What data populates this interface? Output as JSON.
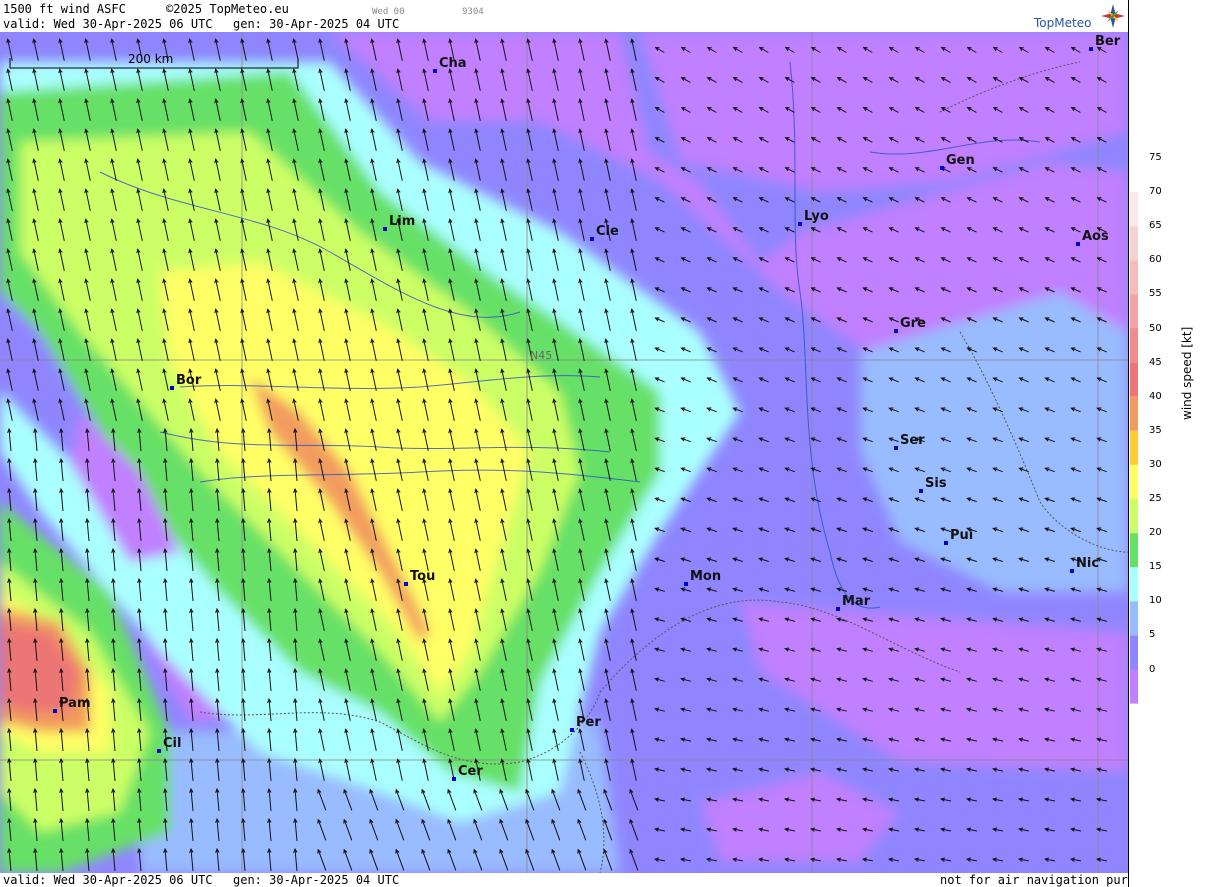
{
  "header": {
    "product": "1500 ft wind ASFC",
    "copyright": "©2025 TopMeteo.eu",
    "day_code": "Wed 00",
    "run_code": "9304",
    "valid": "valid:  Wed  30-Apr-2025  06 UTC",
    "generated": "gen: 30-Apr-2025 04 UTC"
  },
  "footer": {
    "valid": "valid:  Wed  30-Apr-2025  06 UTC",
    "generated": "gen: 30-Apr-2025 04 UTC",
    "disclaimer": "not for air navigation purposes"
  },
  "logo": {
    "text": "TopMeteo"
  },
  "map": {
    "scale_label": "200 km",
    "lat_label": "N45",
    "cities": [
      {
        "id": "cha",
        "label": "Cha"
      },
      {
        "id": "ber",
        "label": "Ber"
      },
      {
        "id": "gen",
        "label": "Gen"
      },
      {
        "id": "lim",
        "label": "Lim"
      },
      {
        "id": "cle",
        "label": "Cle"
      },
      {
        "id": "lyo",
        "label": "Lyo"
      },
      {
        "id": "aos",
        "label": "Aos"
      },
      {
        "id": "gre",
        "label": "Gre"
      },
      {
        "id": "bor",
        "label": "Bor"
      },
      {
        "id": "ser",
        "label": "Ser"
      },
      {
        "id": "sis",
        "label": "Sis"
      },
      {
        "id": "pui",
        "label": "Pui"
      },
      {
        "id": "tou",
        "label": "Tou"
      },
      {
        "id": "mon",
        "label": "Mon"
      },
      {
        "id": "nic",
        "label": "Nic"
      },
      {
        "id": "mar",
        "label": "Mar"
      },
      {
        "id": "pam",
        "label": "Pam"
      },
      {
        "id": "per",
        "label": "Per"
      },
      {
        "id": "cil",
        "label": "Cil"
      },
      {
        "id": "cer",
        "label": "Cer"
      }
    ]
  },
  "legend": {
    "title": "wind speed [kt]",
    "ticks": [
      "75",
      "70",
      "65",
      "60",
      "55",
      "50",
      "45",
      "40",
      "35",
      "30",
      "25",
      "20",
      "15",
      "10",
      "5",
      "0"
    ],
    "colors": [
      "#ffffff",
      "#fbe8e8",
      "#f7d2d2",
      "#f5bcbc",
      "#f2a3a3",
      "#ef8c8c",
      "#ec7575",
      "#f29b5e",
      "#ffcc33",
      "#ffff66",
      "#ccff66",
      "#66e066",
      "#aaffff",
      "#99bbff",
      "#8f86ff",
      "#c080ff"
    ]
  },
  "field_colors": {
    "calm": "#c080ff",
    "light": "#8f86ff",
    "moderate": "#99bbff",
    "fresh": "#aaffff",
    "strong": "#66e066",
    "stronger": "#ccff66",
    "high": "#ffff66",
    "very_high": "#f29b5e",
    "extreme": "#ec7575"
  }
}
